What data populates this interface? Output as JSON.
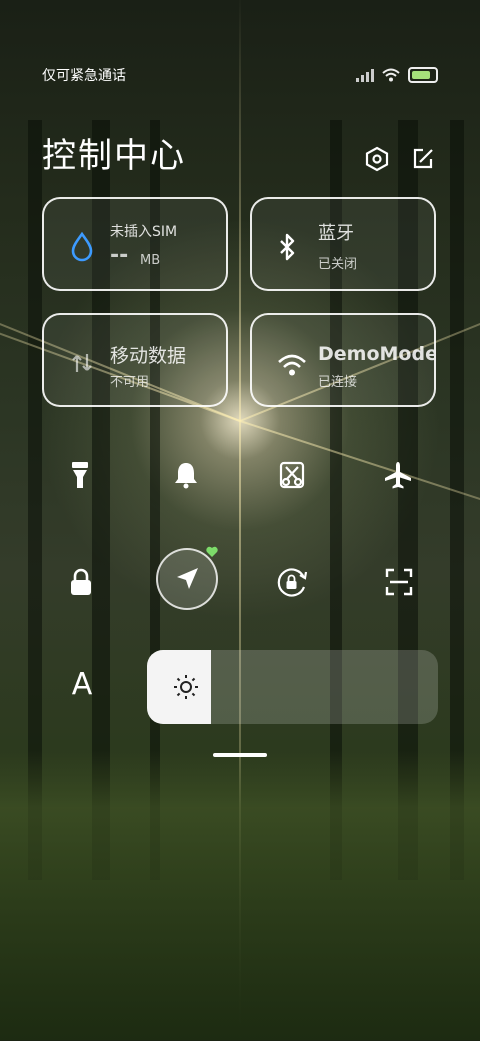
{
  "status_bar": {
    "carrier_text": "仅可紧急通话",
    "battery_color": "#a6e07b",
    "icons": [
      "signal-icon",
      "wifi-icon",
      "battery-icon"
    ]
  },
  "header": {
    "title": "控制中心",
    "settings_icon": "hexagon-settings-icon",
    "edit_icon": "edit-icon"
  },
  "tiles": {
    "data_usage": {
      "label": "未插入SIM",
      "value": "--",
      "unit": "MB",
      "icon": "water-drop-icon",
      "accent": "#3d9bff"
    },
    "bluetooth": {
      "label": "蓝牙",
      "sub": "已关闭",
      "icon": "bluetooth-icon"
    },
    "mobile_data": {
      "label": "移动数据",
      "sub": "不可用",
      "icon": "mobile-data-icon"
    },
    "wifi": {
      "label": "DemoMode",
      "sub": "已连接",
      "icon": "wifi-icon"
    }
  },
  "toggles": [
    {
      "name": "flashlight",
      "icon": "flashlight-icon"
    },
    {
      "name": "notifications",
      "icon": "bell-icon"
    },
    {
      "name": "screenshot",
      "icon": "scissors-icon"
    },
    {
      "name": "airplane",
      "icon": "airplane-icon"
    },
    {
      "name": "lock",
      "icon": "lock-icon"
    },
    {
      "name": "location",
      "icon": "location-arrow-icon",
      "state": "on"
    },
    {
      "name": "rotation-lock",
      "icon": "rotation-lock-icon"
    },
    {
      "name": "scanner",
      "icon": "scan-icon"
    }
  ],
  "brightness": {
    "font_button_label": "A",
    "level": 0.22,
    "icon": "sun-icon"
  }
}
